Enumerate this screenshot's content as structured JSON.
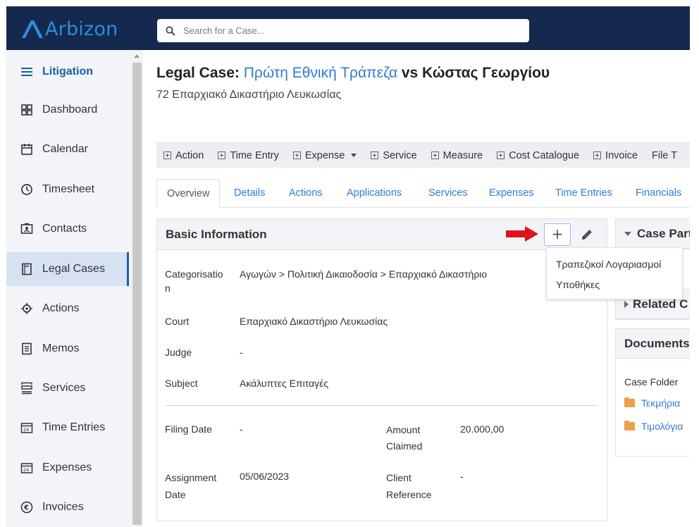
{
  "app": {
    "logo_text": "Arbizon"
  },
  "search": {
    "placeholder": "Search for a Case..."
  },
  "sidebar": {
    "items": [
      {
        "label": "Litigation",
        "icon": "menu-icon"
      },
      {
        "label": "Dashboard",
        "icon": "dashboard-icon"
      },
      {
        "label": "Calendar",
        "icon": "calendar-icon"
      },
      {
        "label": "Timesheet",
        "icon": "clock-icon"
      },
      {
        "label": "Contacts",
        "icon": "contacts-icon"
      },
      {
        "label": "Legal Cases",
        "icon": "legal-case-icon"
      },
      {
        "label": "Actions",
        "icon": "actions-icon"
      },
      {
        "label": "Memos",
        "icon": "memo-icon"
      },
      {
        "label": "Services",
        "icon": "services-icon"
      },
      {
        "label": "Time Entries",
        "icon": "time-entries-icon"
      },
      {
        "label": "Expenses",
        "icon": "expenses-icon"
      },
      {
        "label": "Invoices",
        "icon": "invoices-icon"
      }
    ]
  },
  "case": {
    "title_prefix": "Legal Case: ",
    "client": "Πρώτη Εθνική Τράπεζα",
    "title_suffix": " vs Κώστας Γεωργίου",
    "subtitle": "72 Επαρχιακό Δικαστήριο Λευκωσίας"
  },
  "toolbar": {
    "buttons": [
      "Action",
      "Time Entry",
      "Expense",
      "Service",
      "Measure",
      "Cost Catalogue",
      "Invoice",
      "File T"
    ]
  },
  "tabs": [
    "Overview",
    "Details",
    "Actions",
    "Applications",
    "Services",
    "Expenses",
    "Time Entries",
    "Financials"
  ],
  "basic_info": {
    "title": "Basic Information",
    "add_symbol": "+",
    "fields": {
      "categorisation_label_1": "Categorisatio",
      "categorisation_label_2": "n",
      "categorisation_value": "Αγωγών > Πολιτική Δικαιοδοσία > Επαρχιακό Δικαστήριο",
      "court_label": "Court",
      "court_value": "Επαρχιακό Δικαστήριο Λευκωσίας",
      "judge_label": "Judge",
      "judge_value": "-",
      "subject_label": "Subject",
      "subject_value": "Ακάλυπτες Επιταγές",
      "filing_date_label": "Filing Date",
      "filing_date_value": "-",
      "amount_claimed_label_1": "Amount",
      "amount_claimed_label_2": "Claimed",
      "amount_claimed_value": "20.000,00",
      "assignment_date_label_1": "Assignment",
      "assignment_date_label_2": "Date",
      "assignment_date_value": "05/06/2023",
      "client_reference_label_1": "Client",
      "client_reference_label_2": "Reference",
      "client_reference_value": "-"
    }
  },
  "add_menu": {
    "items": [
      "Τραπεζικοί Λογαριασμοί",
      "Υποθήκες"
    ]
  },
  "right_panels": {
    "case_parties_title": "Case Parties",
    "related_title": "Related C",
    "documents_title": "Documents",
    "case_folder_label": "Case Folder",
    "folders": [
      "Τεκμήρια",
      "Τιμολόγια"
    ]
  },
  "colors": {
    "topbar": "#14294d",
    "brand": "#2c8ddc",
    "link": "#2f7dd1",
    "sidebar_active": "#d6e2f2",
    "arrow": "#e0121b",
    "folder": "#f0a04b"
  }
}
